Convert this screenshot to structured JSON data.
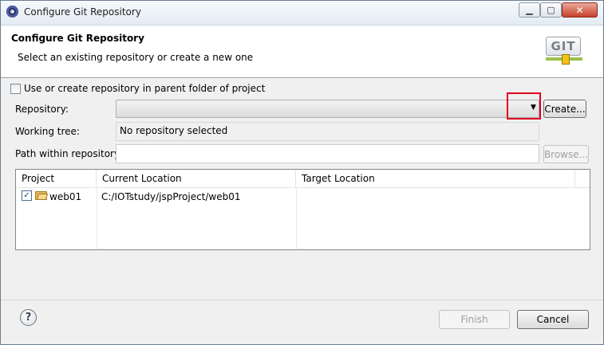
{
  "window": {
    "title": "Configure Git Repository",
    "min_symbol": "▁",
    "max_symbol": "▢",
    "close_symbol": "✕"
  },
  "header": {
    "title": "Configure Git Repository",
    "description": "Select an existing repository or create a new one",
    "logo_text": "GIT"
  },
  "options": {
    "parent_folder_label": "Use or create repository in parent folder of project",
    "parent_folder_checked": false
  },
  "repository": {
    "label": "Repository:",
    "value": "",
    "arrow": "▼",
    "create_label": "Create..."
  },
  "working_tree": {
    "label": "Working tree:",
    "value": "No repository selected"
  },
  "path": {
    "label": "Path within repository:",
    "value": "",
    "browse_label": "Browse..."
  },
  "table": {
    "headers": [
      "Project",
      "Current Location",
      "Target Location"
    ],
    "rows": [
      {
        "checked": true,
        "check_mark": "✓",
        "project": "web01",
        "current_location": "C:/IOTstudy/jspProject/web01",
        "target_location": ""
      }
    ]
  },
  "footer": {
    "help_symbol": "?",
    "finish_label": "Finish",
    "cancel_label": "Cancel"
  },
  "colors": {
    "highlight": "#e0001b",
    "git_green": "#9bc24b",
    "git_yellow": "#f2c21a"
  }
}
